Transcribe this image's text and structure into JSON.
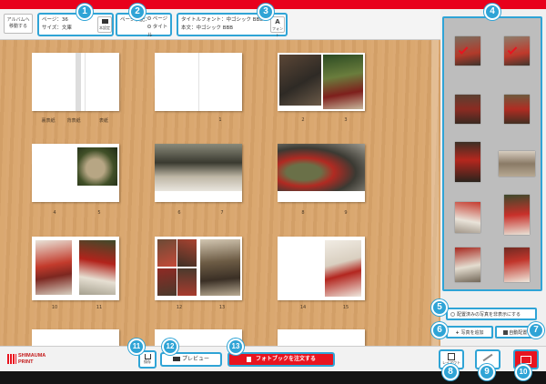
{
  "header": {
    "back_button": {
      "line1": "アルバムへ",
      "line2": "移動する"
    },
    "info": {
      "pages": "ページ：36",
      "size": "サイズ：文庫",
      "settings_label": "本設定"
    },
    "page_notation": {
      "label": "ページ表記：",
      "option_page": "ページ",
      "option_title": "タイトル"
    },
    "fonts": {
      "title_font": "タイトルフォント：中ゴシック BBB",
      "body_font": "本文：中ゴシック BBB",
      "font_button": "フォント"
    }
  },
  "spreads": [
    {
      "left": "裏表紙",
      "middle": "背表紙",
      "right": "表紙"
    },
    {
      "left": "",
      "right": "1"
    },
    {
      "left": "2",
      "right": "3"
    },
    {
      "left": "4",
      "right": "5"
    },
    {
      "left": "6",
      "right": "7"
    },
    {
      "left": "8",
      "right": "9"
    },
    {
      "left": "10",
      "right": "11"
    },
    {
      "left": "12",
      "right": "13"
    },
    {
      "left": "14",
      "right": "15"
    }
  ],
  "sidebar": {
    "hide_placed_label": "配置済みの写真を非表示にする",
    "add_photo_label": "写真を追加",
    "auto_place_label": "自動配置"
  },
  "footer": {
    "logo_text1": "SHIMAUMA",
    "logo_text2": "PRINT",
    "save_label": "保存",
    "preview_label": "プレビュー",
    "order_label": "フォトブックを注文する",
    "layout_label": "レイアウト"
  },
  "badges": [
    "1",
    "2",
    "3",
    "4",
    "5",
    "6",
    "7",
    "8",
    "9",
    "10",
    "11",
    "12",
    "13"
  ],
  "colors": {
    "accent": "#2fa4d6",
    "order_red": "#e8141f",
    "wood": "#d9a46a"
  }
}
